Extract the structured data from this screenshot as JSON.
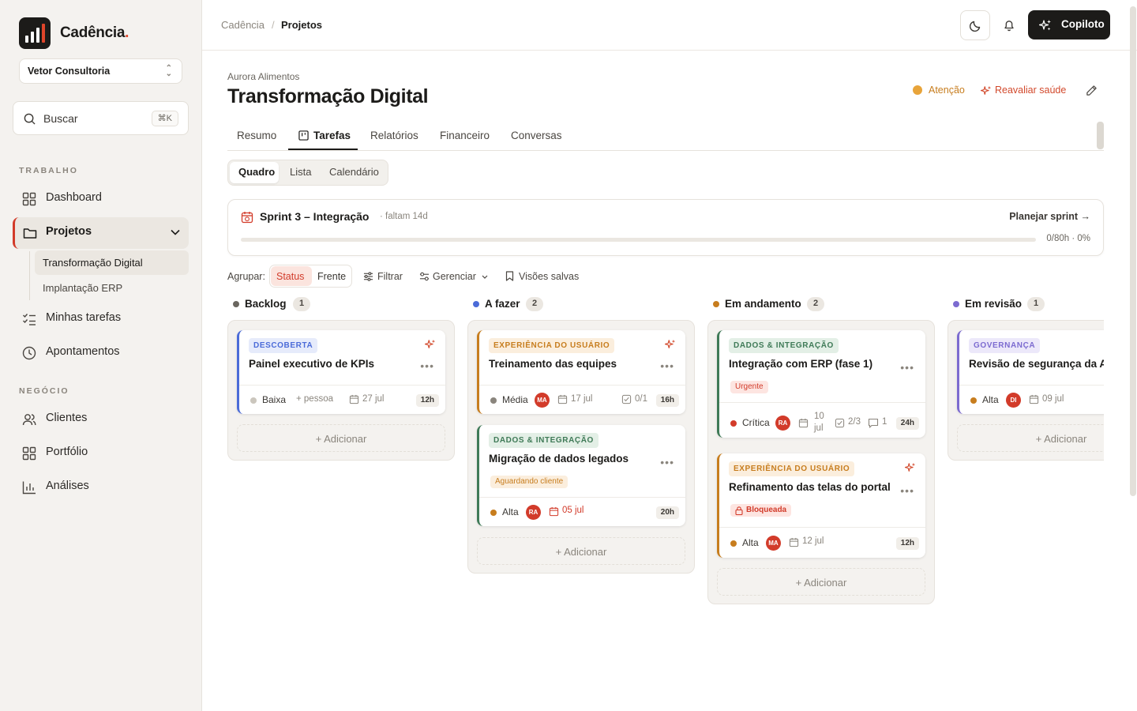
{
  "app": {
    "name": "Cadência",
    "dot": "."
  },
  "workspace": {
    "name": "Vetor Consultoria"
  },
  "search": {
    "label": "Buscar",
    "shortcut": "⌘K"
  },
  "sidebar": {
    "section_work": "TRABALHO",
    "section_business": "NEGÓCIO",
    "items": [
      {
        "label": "Dashboard",
        "icon": "grid-icon"
      },
      {
        "label": "Projetos",
        "icon": "folder-icon"
      },
      {
        "label": "Minhas tarefas",
        "icon": "checklist-icon"
      },
      {
        "label": "Apontamentos",
        "icon": "clock-icon"
      },
      {
        "label": "Clientes",
        "icon": "users-icon"
      },
      {
        "label": "Portfólio",
        "icon": "grid-icon"
      },
      {
        "label": "Análises",
        "icon": "bar-chart-icon"
      }
    ],
    "projects": [
      "Transformação Digital",
      "Implantação ERP"
    ]
  },
  "header": {
    "breadcrumb": [
      "Cadência",
      "Projetos"
    ],
    "breadcrumb_sep": "/",
    "copilot_label": "Copiloto"
  },
  "project": {
    "client": "Aurora Alimentos",
    "title": "Transformação Digital",
    "health": "Atenção",
    "reassess": "Reavaliar saúde"
  },
  "tabs": [
    "Resumo",
    "Tarefas",
    "Relatórios",
    "Financeiro",
    "Conversas"
  ],
  "views": [
    "Quadro",
    "Lista",
    "Calendário"
  ],
  "sprint": {
    "title": "Sprint 3 – Integração",
    "remaining": "· faltam 14d",
    "plan": "Planejar sprint →",
    "progress_text": "0/80h · 0%",
    "progress": 0
  },
  "toolbar": {
    "group_label": "Agrupar:",
    "group_options": [
      "Status",
      "Frente"
    ],
    "filter": "Filtrar",
    "manage": "Gerenciar",
    "saved": "Visões salvas"
  },
  "add_label": "Adicionar",
  "columns": [
    {
      "name": "Backlog",
      "count": "1",
      "color": "#6a665f"
    },
    {
      "name": "A fazer",
      "count": "2",
      "color": "#4b6bd8"
    },
    {
      "name": "Em andamento",
      "count": "2",
      "color": "#c77d1e"
    },
    {
      "name": "Em revisão",
      "count": "1",
      "color": "#7c6bd0"
    }
  ],
  "cards": {
    "c1": {
      "tag": "DESCOBERTA",
      "title": "Painel executivo de KPIs",
      "priority": "Baixa",
      "assignee": "+ pessoa",
      "date": "27 jul",
      "hours": "12h"
    },
    "c2": {
      "tag": "EXPERIÊNCIA DO USUÁRIO",
      "title": "Treinamento das equipes",
      "priority": "Média",
      "avatar": "MA",
      "date": "17 jul",
      "checks": "0/1",
      "hours": "16h"
    },
    "c3": {
      "tag": "DADOS & INTEGRAÇÃO",
      "title": "Migração de dados legados",
      "badge": "Aguardando cliente",
      "priority": "Alta",
      "avatar": "RA",
      "date": "05 jul",
      "hours": "20h"
    },
    "c4": {
      "tag": "DADOS & INTEGRAÇÃO",
      "title": "Integração com ERP (fase 1)",
      "badge": "Urgente",
      "priority": "Crítica",
      "avatar": "RA",
      "date_a": "10",
      "date_b": "jul",
      "checks": "2/3",
      "comments": "1",
      "hours": "24h"
    },
    "c5": {
      "tag": "EXPERIÊNCIA DO USUÁRIO",
      "title": "Refinamento das telas do portal",
      "badge": "Bloqueada",
      "priority": "Alta",
      "avatar": "MA",
      "date": "12 jul",
      "hours": "12h"
    },
    "c6": {
      "tag": "GOVERNANÇA",
      "title": "Revisão de segurança da A",
      "priority": "Alta",
      "avatar": "DI",
      "date": "09 jul"
    }
  },
  "colors": {
    "accent": "#d23b2a",
    "ink": "#1c1b19",
    "warning": "#c77d1e"
  }
}
